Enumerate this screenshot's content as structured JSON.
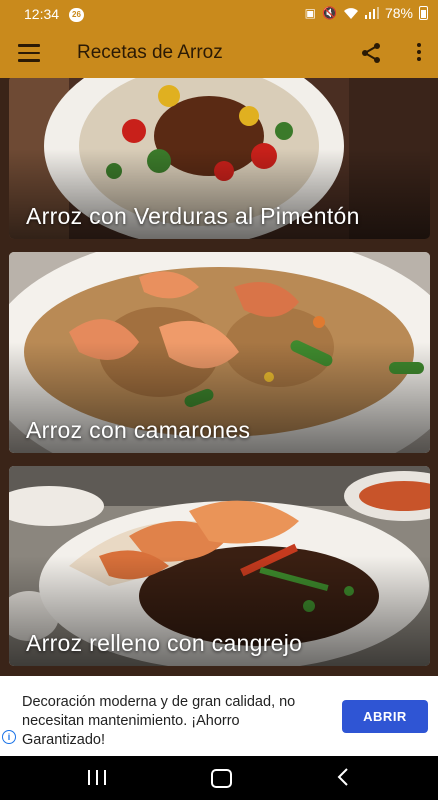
{
  "status_bar": {
    "time": "12:34",
    "notification_count": "26",
    "battery": "78%"
  },
  "app_bar": {
    "title": "Recetas de Arroz",
    "menu_icon": "hamburger-menu-icon",
    "share_icon": "share-icon",
    "more_icon": "more-vert-icon"
  },
  "recipes": [
    {
      "title": "Arroz con Verduras al Pimentón"
    },
    {
      "title": "Arroz con camarones"
    },
    {
      "title": "Arroz relleno con cangrejo"
    }
  ],
  "ad": {
    "text": "Decoración moderna y de gran calidad, no necesitan mantenimiento. ¡Ahorro Garantizado!",
    "button_label": "ABRIR",
    "button_color": "#2f55d4"
  },
  "colors": {
    "app_bar": "#c98a1c"
  }
}
